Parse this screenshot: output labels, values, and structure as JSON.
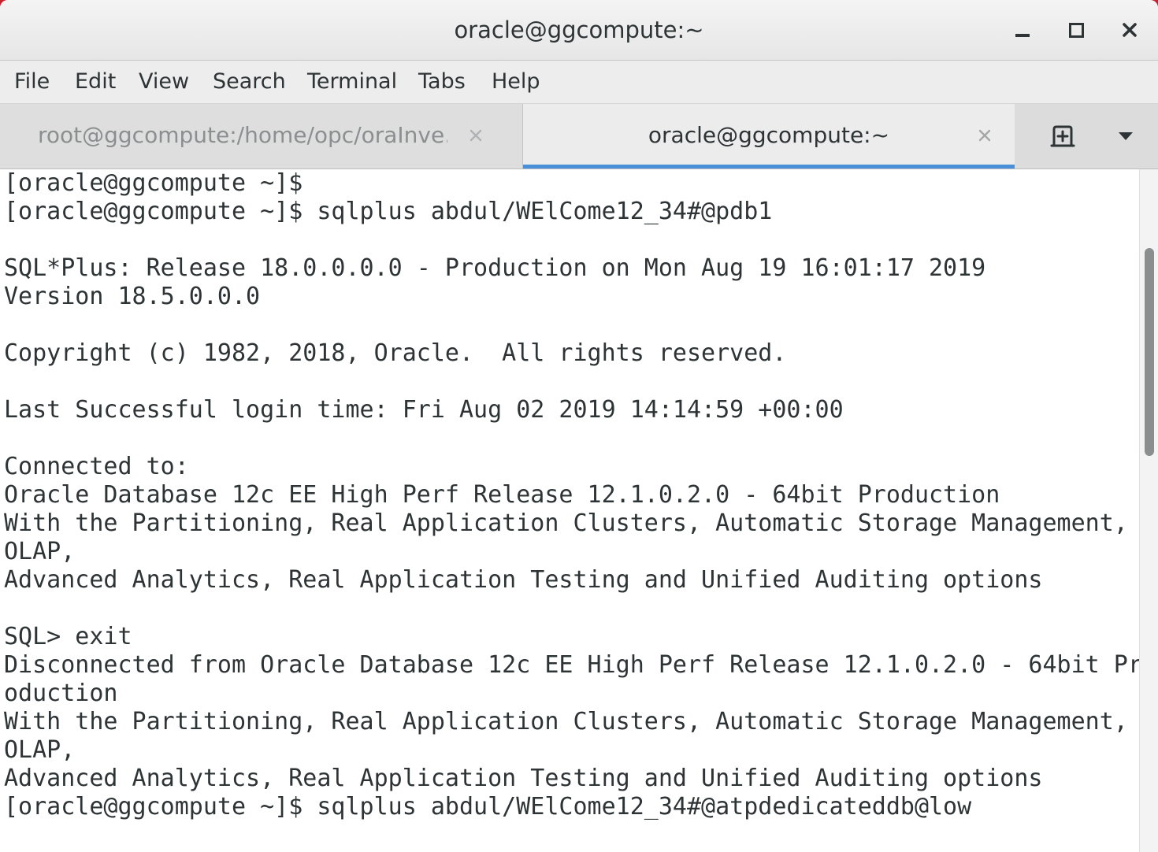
{
  "window": {
    "title": "oracle@ggcompute:~"
  },
  "menu": [
    "File",
    "Edit",
    "View",
    "Search",
    "Terminal",
    "Tabs",
    "Help"
  ],
  "tabs": [
    {
      "label": "root@ggcompute:/home/opc/oraInve...",
      "active": false
    },
    {
      "label": "oracle@ggcompute:~",
      "active": true
    }
  ],
  "icons": {
    "minimize": "minimize-icon",
    "maximize": "maximize-icon",
    "close": "close-icon",
    "tab_close": "close-icon",
    "new_tab": "new-tab-icon",
    "dropdown": "chevron-down-icon"
  },
  "colors": {
    "accent": "#4a90d9",
    "desktop": "#c8202c"
  },
  "terminal": {
    "lines": [
      "[oracle@ggcompute ~]$",
      "[oracle@ggcompute ~]$ sqlplus abdul/WElCome12_34#@pdb1",
      "",
      "SQL*Plus: Release 18.0.0.0.0 - Production on Mon Aug 19 16:01:17 2019",
      "Version 18.5.0.0.0",
      "",
      "Copyright (c) 1982, 2018, Oracle.  All rights reserved.",
      "",
      "Last Successful login time: Fri Aug 02 2019 14:14:59 +00:00",
      "",
      "Connected to:",
      "Oracle Database 12c EE High Perf Release 12.1.0.2.0 - 64bit Production",
      "With the Partitioning, Real Application Clusters, Automatic Storage Management,",
      "OLAP,",
      "Advanced Analytics, Real Application Testing and Unified Auditing options",
      "",
      "SQL> exit",
      "Disconnected from Oracle Database 12c EE High Perf Release 12.1.0.2.0 - 64bit Pr",
      "oduction",
      "With the Partitioning, Real Application Clusters, Automatic Storage Management,",
      "OLAP,",
      "Advanced Analytics, Real Application Testing and Unified Auditing options",
      "[oracle@ggcompute ~]$ sqlplus abdul/WElCome12_34#@atpdedicateddb@low"
    ]
  }
}
